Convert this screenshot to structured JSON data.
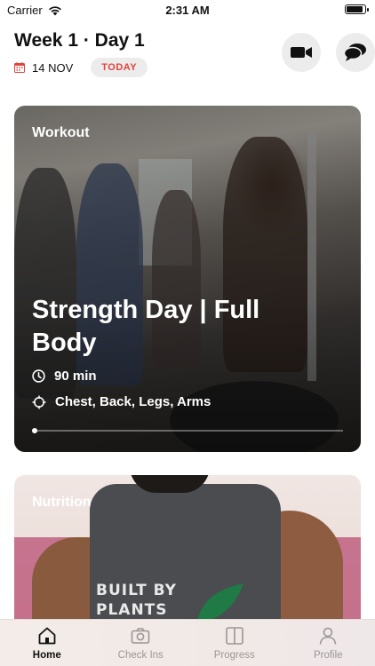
{
  "status_bar": {
    "carrier": "Carrier",
    "time": "2:31 AM"
  },
  "header": {
    "title": "Week 1 · Day 1",
    "date": "14 NOV",
    "today_badge": "TODAY",
    "video_button_icon": "video-camera-icon",
    "chat_button_icon": "chat-bubbles-icon"
  },
  "workout_card": {
    "label": "Workout",
    "title": "Strength Day | Full Body",
    "duration": "90 min",
    "muscles": "Chest, Back, Legs, Arms"
  },
  "nutrition_card": {
    "label": "Nutrition",
    "shirt_text_line1": "BUILT BY",
    "shirt_text_line2": "PLANTS"
  },
  "tabs": [
    {
      "label": "Home",
      "icon": "home-icon",
      "active": true
    },
    {
      "label": "Check Ins",
      "icon": "camera-icon",
      "active": false
    },
    {
      "label": "Progress",
      "icon": "split-panel-icon",
      "active": false
    },
    {
      "label": "Profile",
      "icon": "person-icon",
      "active": false
    }
  ],
  "colors": {
    "accent": "#e0443c",
    "badge_bg": "#ececec",
    "tab_inactive": "#9a9696"
  }
}
